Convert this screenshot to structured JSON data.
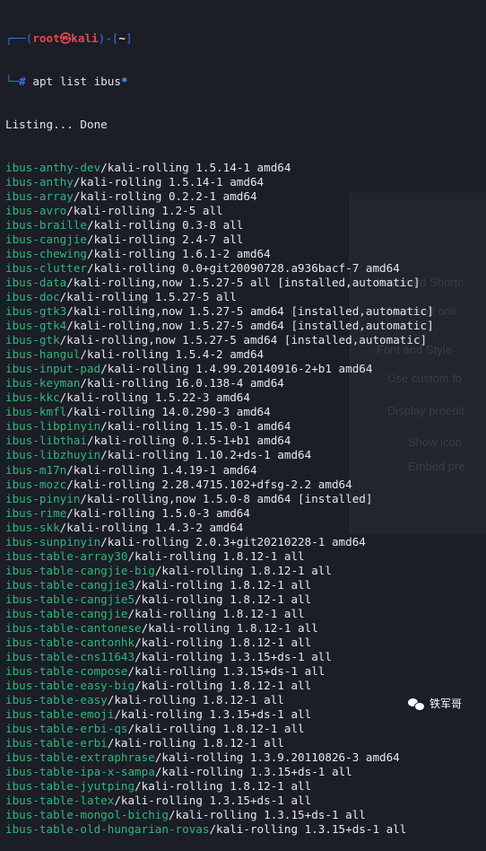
{
  "prompt": {
    "frame_top": "┌──(",
    "user": "root",
    "at": "㉿",
    "host": "kali",
    "frame_mid": ")-[",
    "path": "~",
    "frame_end": "]",
    "frame_bottom": "└─",
    "hash": "#",
    "command": "apt list ibus",
    "glob": "*"
  },
  "status_line": "Listing... Done",
  "packages": [
    {
      "name": "ibus-anthy-dev",
      "rest": "/kali-rolling 1.5.14-1 amd64"
    },
    {
      "name": "ibus-anthy",
      "rest": "/kali-rolling 1.5.14-1 amd64"
    },
    {
      "name": "ibus-array",
      "rest": "/kali-rolling 0.2.2-1 amd64"
    },
    {
      "name": "ibus-avro",
      "rest": "/kali-rolling 1.2-5 all"
    },
    {
      "name": "ibus-braille",
      "rest": "/kali-rolling 0.3-8 all"
    },
    {
      "name": "ibus-cangjie",
      "rest": "/kali-rolling 2.4-7 all"
    },
    {
      "name": "ibus-chewing",
      "rest": "/kali-rolling 1.6.1-2 amd64"
    },
    {
      "name": "ibus-clutter",
      "rest": "/kali-rolling 0.0+git20090728.a936bacf-7 amd64"
    },
    {
      "name": "ibus-data",
      "rest": "/kali-rolling,now 1.5.27-5 all [installed,automatic]"
    },
    {
      "name": "ibus-doc",
      "rest": "/kali-rolling 1.5.27-5 all"
    },
    {
      "name": "ibus-gtk3",
      "rest": "/kali-rolling,now 1.5.27-5 amd64 [installed,automatic]"
    },
    {
      "name": "ibus-gtk4",
      "rest": "/kali-rolling,now 1.5.27-5 amd64 [installed,automatic]"
    },
    {
      "name": "ibus-gtk",
      "rest": "/kali-rolling,now 1.5.27-5 amd64 [installed,automatic]"
    },
    {
      "name": "ibus-hangul",
      "rest": "/kali-rolling 1.5.4-2 amd64"
    },
    {
      "name": "ibus-input-pad",
      "rest": "/kali-rolling 1.4.99.20140916-2+b1 amd64"
    },
    {
      "name": "ibus-keyman",
      "rest": "/kali-rolling 16.0.138-4 amd64"
    },
    {
      "name": "ibus-kkc",
      "rest": "/kali-rolling 1.5.22-3 amd64"
    },
    {
      "name": "ibus-kmfl",
      "rest": "/kali-rolling 14.0.290-3 amd64"
    },
    {
      "name": "ibus-libpinyin",
      "rest": "/kali-rolling 1.15.0-1 amd64"
    },
    {
      "name": "ibus-libthai",
      "rest": "/kali-rolling 0.1.5-1+b1 amd64"
    },
    {
      "name": "ibus-libzhuyin",
      "rest": "/kali-rolling 1.10.2+ds-1 amd64"
    },
    {
      "name": "ibus-m17n",
      "rest": "/kali-rolling 1.4.19-1 amd64"
    },
    {
      "name": "ibus-mozc",
      "rest": "/kali-rolling 2.28.4715.102+dfsg-2.2 amd64"
    },
    {
      "name": "ibus-pinyin",
      "rest": "/kali-rolling,now 1.5.0-8 amd64 [installed]"
    },
    {
      "name": "ibus-rime",
      "rest": "/kali-rolling 1.5.0-3 amd64"
    },
    {
      "name": "ibus-skk",
      "rest": "/kali-rolling 1.4.3-2 amd64"
    },
    {
      "name": "ibus-sunpinyin",
      "rest": "/kali-rolling 2.0.3+git20210228-1 amd64"
    },
    {
      "name": "ibus-table-array30",
      "rest": "/kali-rolling 1.8.12-1 all"
    },
    {
      "name": "ibus-table-cangjie-big",
      "rest": "/kali-rolling 1.8.12-1 all"
    },
    {
      "name": "ibus-table-cangjie3",
      "rest": "/kali-rolling 1.8.12-1 all"
    },
    {
      "name": "ibus-table-cangjie5",
      "rest": "/kali-rolling 1.8.12-1 all"
    },
    {
      "name": "ibus-table-cangjie",
      "rest": "/kali-rolling 1.8.12-1 all"
    },
    {
      "name": "ibus-table-cantonese",
      "rest": "/kali-rolling 1.8.12-1 all"
    },
    {
      "name": "ibus-table-cantonhk",
      "rest": "/kali-rolling 1.8.12-1 all"
    },
    {
      "name": "ibus-table-cns11643",
      "rest": "/kali-rolling 1.3.15+ds-1 all"
    },
    {
      "name": "ibus-table-compose",
      "rest": "/kali-rolling 1.3.15+ds-1 all"
    },
    {
      "name": "ibus-table-easy-big",
      "rest": "/kali-rolling 1.8.12-1 all"
    },
    {
      "name": "ibus-table-easy",
      "rest": "/kali-rolling 1.8.12-1 all"
    },
    {
      "name": "ibus-table-emoji",
      "rest": "/kali-rolling 1.3.15+ds-1 all"
    },
    {
      "name": "ibus-table-erbi-qs",
      "rest": "/kali-rolling 1.8.12-1 all"
    },
    {
      "name": "ibus-table-erbi",
      "rest": "/kali-rolling 1.8.12-1 all"
    },
    {
      "name": "ibus-table-extraphrase",
      "rest": "/kali-rolling 1.3.9.20110826-3 amd64"
    },
    {
      "name": "ibus-table-ipa-x-sampa",
      "rest": "/kali-rolling 1.3.15+ds-1 all"
    },
    {
      "name": "ibus-table-jyutping",
      "rest": "/kali-rolling 1.8.12-1 all"
    },
    {
      "name": "ibus-table-latex",
      "rest": "/kali-rolling 1.3.15+ds-1 all"
    },
    {
      "name": "ibus-table-mongol-bichig",
      "rest": "/kali-rolling 1.3.15+ds-1 all"
    },
    {
      "name": "ibus-table-old-hungarian-rovas",
      "rest": "/kali-rolling 1.3.15+ds-1 all"
    }
  ],
  "watermark": {
    "text": "铁军哥",
    "icon": "wechat-icon"
  },
  "background_ghost": {
    "items": [
      "Keyboard Shortc",
      "Microsoft onli",
      "Font and Style",
      "Use custom fo",
      "Display preedit",
      "Show icon",
      "Embed pre"
    ]
  },
  "colors": {
    "background": "#1b1d27",
    "prompt_frame": "#3a6ee8",
    "prompt_user": "#e5484d",
    "package_name": "#2fb87a",
    "glob": "#4fa3f7",
    "text": "#e8e8e8"
  }
}
